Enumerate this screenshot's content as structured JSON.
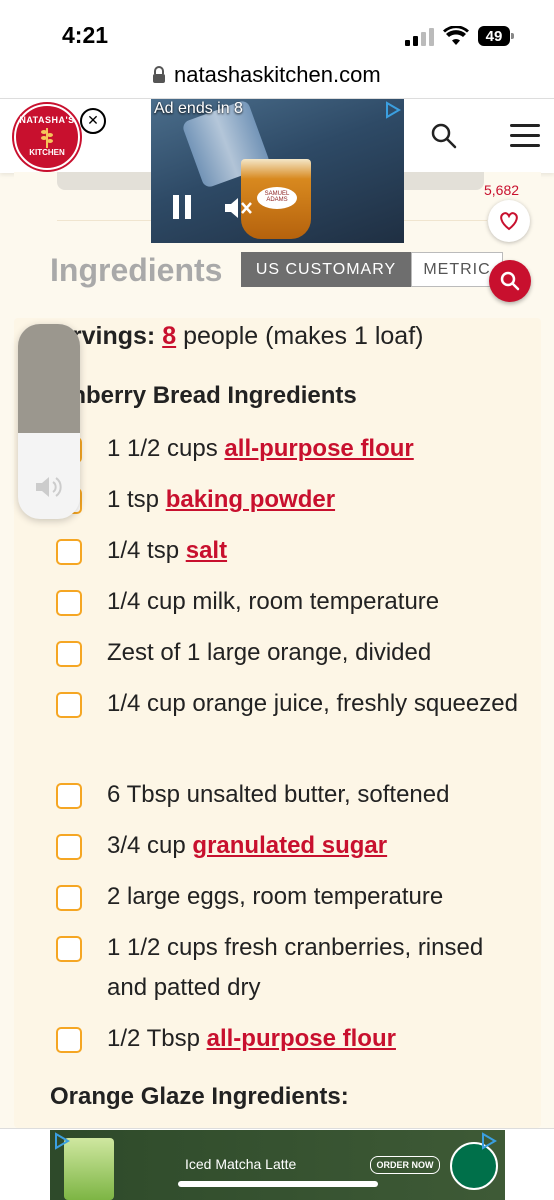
{
  "status_bar": {
    "time": "4:21",
    "battery": "49"
  },
  "browser": {
    "url": "natashaskitchen.com"
  },
  "site": {
    "logo_top": "NATASHA'S",
    "logo_bottom": "KITCHEN",
    "favorites_count": "5,682"
  },
  "video_ad": {
    "countdown": "Ad ends in 8",
    "brand": "SAMUEL ADAMS"
  },
  "ingredients": {
    "heading": "Ingredients",
    "tab_us": "US CUSTOMARY",
    "tab_metric": "METRIC",
    "servings_label": "ervings:",
    "servings_value": "8",
    "servings_unit": "people (makes 1 loaf)",
    "group1_title": "anberry Bread Ingredients",
    "group2_title": "Orange Glaze Ingredients:",
    "items": [
      {
        "text": "1 1/2 cups ",
        "link": "all-purpose flour"
      },
      {
        "text": "1 tsp ",
        "link": "baking powder"
      },
      {
        "text": "1/4 tsp ",
        "link": "salt"
      },
      {
        "text": "1/4 cup milk, room temperature",
        "link": ""
      },
      {
        "text": "Zest of 1 large orange, divided",
        "link": ""
      },
      {
        "text": "1/4 cup orange juice, freshly squeezed",
        "link": ""
      },
      {
        "text": "6 Tbsp unsalted butter, softened",
        "link": ""
      },
      {
        "text": "3/4 cup ",
        "link": "granulated sugar"
      },
      {
        "text": "2 large eggs, room temperature",
        "link": ""
      },
      {
        "text": "1 1/2 cups fresh cranberries, rinsed and patted dry",
        "link": ""
      },
      {
        "text": "1/2 Tbsp ",
        "link": "all-purpose flour"
      }
    ]
  },
  "bottom_ad": {
    "text": "Iced Matcha Latte",
    "button": "ORDER NOW"
  },
  "volume": {
    "level": 0.56
  },
  "colors": {
    "accent": "#c8102e",
    "checkbox": "#f5a623",
    "panel": "#fdf6e6"
  }
}
